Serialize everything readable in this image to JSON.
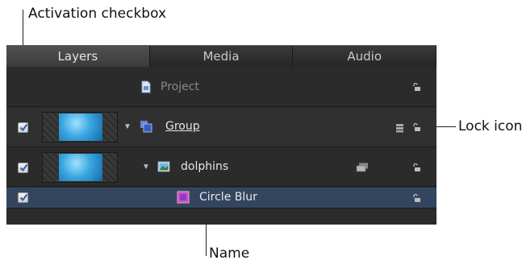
{
  "callouts": {
    "activation_checkbox": "Activation checkbox",
    "lock_icon": "Lock icon",
    "name": "Name"
  },
  "tabs": [
    {
      "label": "Layers",
      "active": true
    },
    {
      "label": "Media",
      "active": false
    },
    {
      "label": "Audio",
      "active": false
    }
  ],
  "layers": {
    "project": {
      "label": "Project",
      "icon": "project-icon",
      "locked": false
    },
    "group": {
      "label": "Group",
      "icon": "group-icon",
      "checked": true,
      "expanded": true,
      "locked": false
    },
    "dolphins": {
      "label": "dolphins",
      "icon": "image-icon",
      "checked": true,
      "expanded": true,
      "locked": false
    },
    "circle_blur": {
      "label": "Circle Blur",
      "icon": "filter-icon",
      "checked": true,
      "selected": true,
      "locked": false
    }
  },
  "colors": {
    "panel_bg": "#2a2a2a",
    "selected_row": "#34465f",
    "tab_active": "#505050"
  }
}
